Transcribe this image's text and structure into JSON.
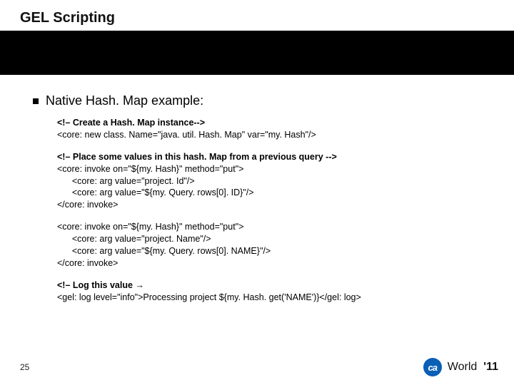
{
  "title": "GEL Scripting",
  "heading": "Native Hash. Map example:",
  "groups": [
    {
      "lines": [
        {
          "text": "<!– Create a Hash. Map instance-->",
          "bold": true
        },
        {
          "text": "<core: new class. Name=\"java. util. Hash. Map\" var=\"my. Hash\"/>",
          "bold": false
        }
      ]
    },
    {
      "lines": [
        {
          "text": "<!– Place some values in this hash. Map from a previous query -->",
          "bold": true
        },
        {
          "text": "<core: invoke on=\"${my. Hash}\" method=\"put\">",
          "bold": false
        },
        {
          "text": "      <core: arg value=\"project. Id\"/>",
          "bold": false
        },
        {
          "text": "      <core: arg value=\"${my. Query. rows[0]. ID}\"/>",
          "bold": false
        },
        {
          "text": "</core: invoke>",
          "bold": false
        }
      ]
    },
    {
      "lines": [
        {
          "text": "<core: invoke on=\"${my. Hash}\" method=\"put\">",
          "bold": false
        },
        {
          "text": "      <core: arg value=\"project. Name\"/>",
          "bold": false
        },
        {
          "text": "      <core: arg value=\"${my. Query. rows[0]. NAME}\"/>",
          "bold": false
        },
        {
          "text": "</core: invoke>",
          "bold": false
        }
      ]
    },
    {
      "lines": [
        {
          "text": "<!– Log this value →",
          "bold": true
        },
        {
          "text": "<gel: log level=\"info\">Processing project ${my. Hash. get('NAME')}</gel: log>",
          "bold": false
        }
      ]
    }
  ],
  "footer": {
    "page": "25",
    "logo_text": "ca",
    "brand_word": "World",
    "brand_year": "'11"
  }
}
